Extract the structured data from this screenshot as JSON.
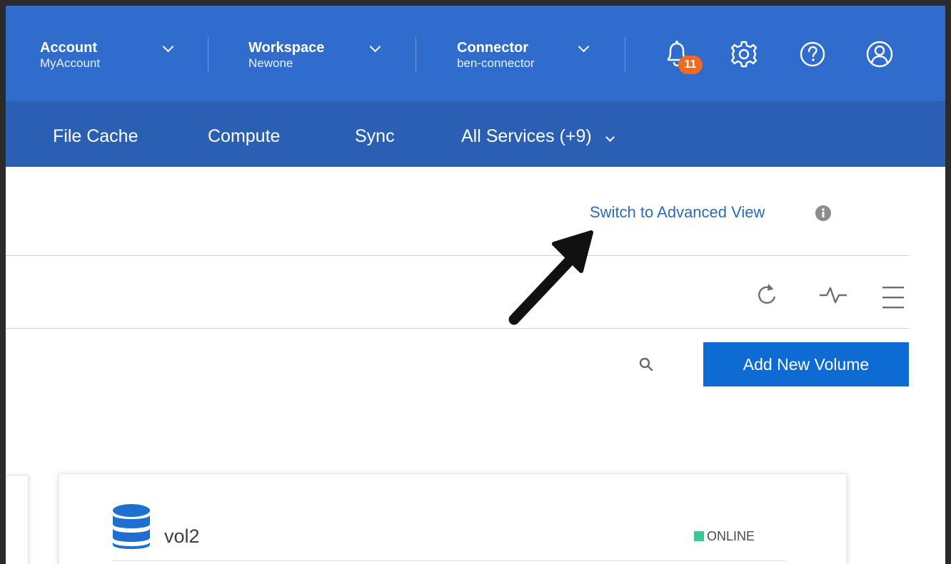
{
  "header": {
    "account": {
      "label": "Account",
      "value": "MyAccount"
    },
    "workspace": {
      "label": "Workspace",
      "value": "Newone"
    },
    "connector": {
      "label": "Connector",
      "value": "ben-connector"
    },
    "notifications_count": "11",
    "icons": [
      "bell-icon",
      "gear-icon",
      "help-icon",
      "user-icon"
    ]
  },
  "nav": {
    "items": [
      {
        "label": "File Cache"
      },
      {
        "label": "Compute"
      },
      {
        "label": "Sync"
      },
      {
        "label": "All Services (+9)"
      }
    ]
  },
  "content": {
    "advanced_view_link": "Switch to Advanced View",
    "add_volume_button": "Add New Volume",
    "toolbar_icons": [
      "refresh-icon",
      "activity-icon",
      "menu-icon"
    ]
  },
  "volume": {
    "name": "vol2",
    "status": "ONLINE",
    "status_color": "#3cc79a"
  },
  "colors": {
    "header_bg": "#2f6ccb",
    "nav_bg": "#2a5fb3",
    "link": "#2d6ab9",
    "button": "#0d6bd3",
    "badge": "#ef6a1f"
  }
}
